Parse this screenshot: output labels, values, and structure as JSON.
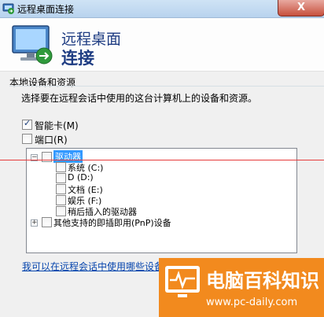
{
  "window": {
    "title": "远程桌面连接",
    "close_glyph": "X"
  },
  "header": {
    "line1": "远程桌面",
    "line2": "连接"
  },
  "group": {
    "label": "本地设备和资源",
    "description": "选择要在远程会话中使用的这台计算机上的设备和资源。"
  },
  "options": {
    "smartcard": "智能卡(M)",
    "ports": "端口(R)"
  },
  "tree": {
    "drives": "驱动器",
    "items": [
      "系统 (C:)",
      "D (D:)",
      "文档 (E:)",
      "娱乐 (F:)",
      "稍后插入的驱动器"
    ],
    "other": "其他支持的即插即用(PnP)设备"
  },
  "link": "我可以在远程会话中使用哪些设备?",
  "watermark": {
    "title": "电脑百科知识",
    "url": "www.pc-daily.com"
  },
  "colors": {
    "accent": "#1e3c82",
    "watermark_orange": "#f28a1e",
    "link": "#0645ad"
  }
}
